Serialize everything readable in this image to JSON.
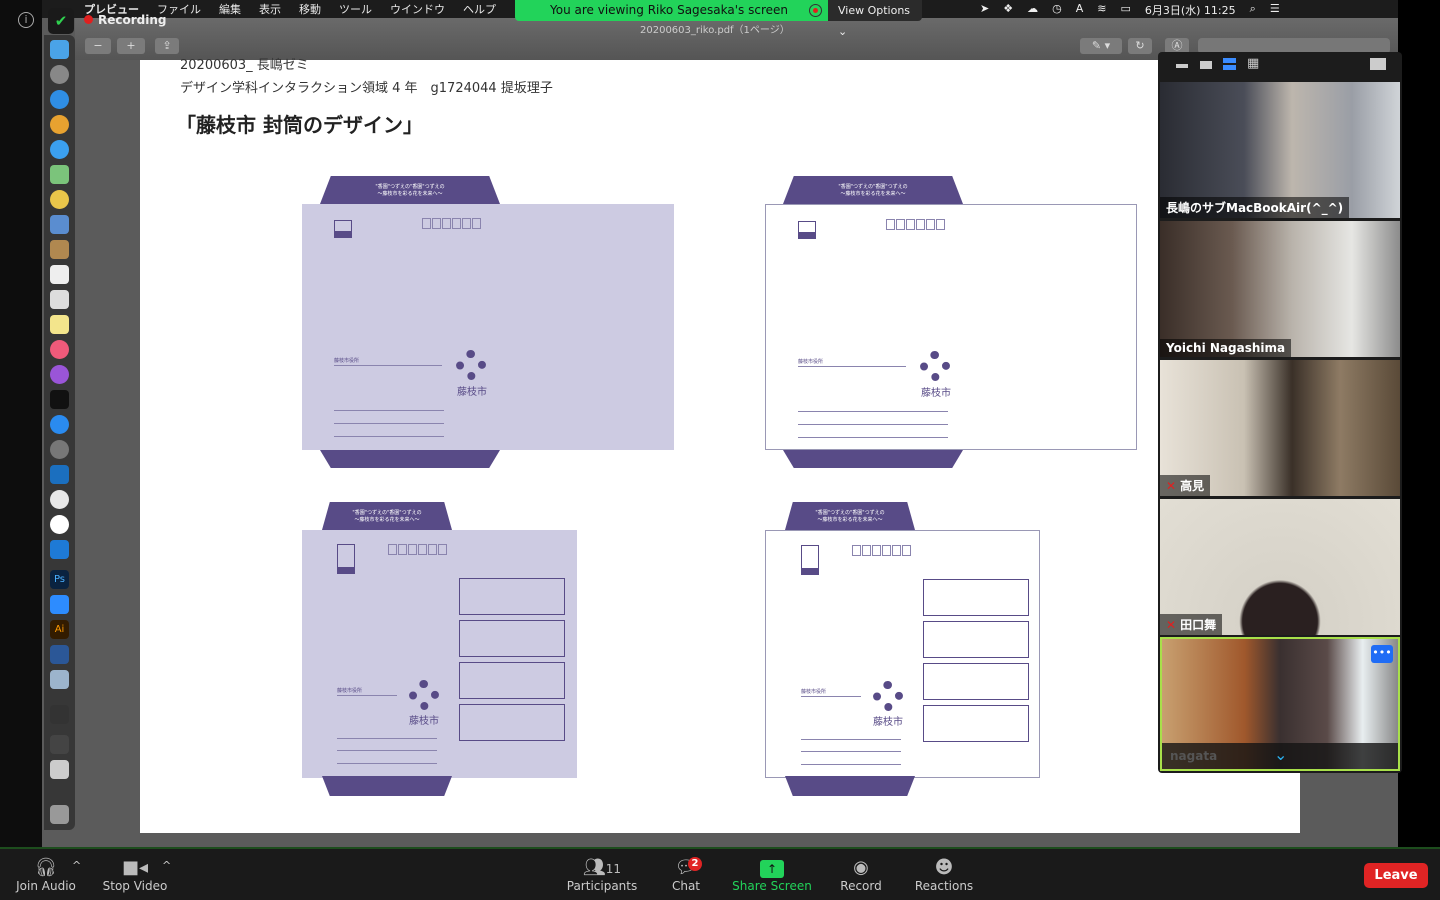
{
  "menubar": {
    "app": "プレビュー",
    "items": [
      "ファイル",
      "編集",
      "表示",
      "移動",
      "ツール",
      "ウインドウ",
      "ヘルプ"
    ],
    "datetime": "6月3日(水) 11:25"
  },
  "recording": "Recording",
  "share_banner": {
    "text": "You are viewing Riko Sagesaka's screen",
    "view_options": "View Options"
  },
  "preview": {
    "file_title": "20200603_riko.pdf（1ページ）"
  },
  "document": {
    "line1": "20200603_ 長嶋ゼミ",
    "line2": "デザイン学科インタラクション領域 4 年　g1724044 提坂理子",
    "title": "「藤枝市 封筒のデザイン」",
    "logo_text": "藤枝市",
    "flap_text": "\"香園\"つずえの\"香園\"つずえの\n〜藤枝市を彩る花を未来へ〜"
  },
  "colors": {
    "envelope_purple": "#584b87",
    "envelope_lavender": "#cdcbe2",
    "share_green": "#22d35a",
    "leave_red": "#e02424"
  },
  "participants_panel": {
    "tiles": [
      {
        "name": "長嶋のサブMacBookAir(^_^)",
        "muted": false
      },
      {
        "name": "Yoichi Nagashima",
        "muted": false
      },
      {
        "name": "高見",
        "muted": true
      },
      {
        "name": "田口舞",
        "muted": true
      },
      {
        "name": "nagata",
        "muted": true,
        "active": true
      }
    ]
  },
  "bottombar": {
    "join_audio": "Join Audio",
    "stop_video": "Stop Video",
    "participants": "Participants",
    "participant_count": "11",
    "chat": "Chat",
    "chat_badge": "2",
    "share_screen": "Share Screen",
    "record": "Record",
    "reactions": "Reactions",
    "leave": "Leave"
  }
}
